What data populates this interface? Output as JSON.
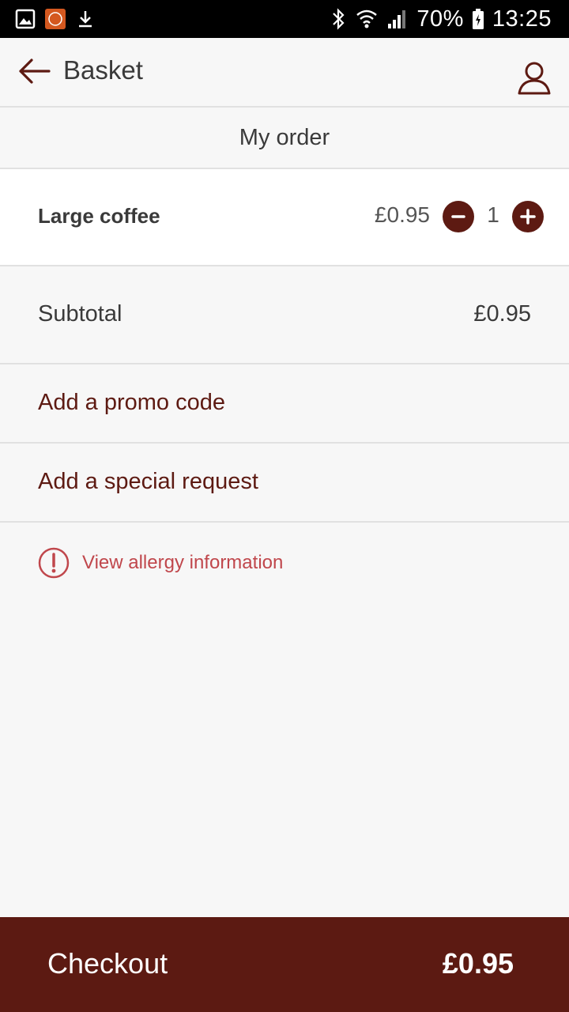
{
  "status_bar": {
    "battery": "70%",
    "time": "13:25",
    "icons": [
      "gallery-icon",
      "app-notification-icon",
      "download-icon",
      "bluetooth-icon",
      "wifi-icon",
      "signal-icon",
      "battery-icon"
    ]
  },
  "app_bar": {
    "title": "Basket",
    "back_icon": "arrow-left-icon",
    "profile_icon": "user-icon"
  },
  "order": {
    "section_title": "My order",
    "items": [
      {
        "name": "Large coffee",
        "price": "£0.95",
        "quantity": "1"
      }
    ],
    "subtotal_label": "Subtotal",
    "subtotal_value": "£0.95"
  },
  "links": {
    "promo": "Add a promo code",
    "special_request": "Add a special request",
    "allergy": "View allergy information"
  },
  "checkout": {
    "label": "Checkout",
    "total": "£0.95"
  },
  "colors": {
    "brand": "#5c1a12",
    "allergy": "#c0474c",
    "background": "#f7f7f7"
  }
}
